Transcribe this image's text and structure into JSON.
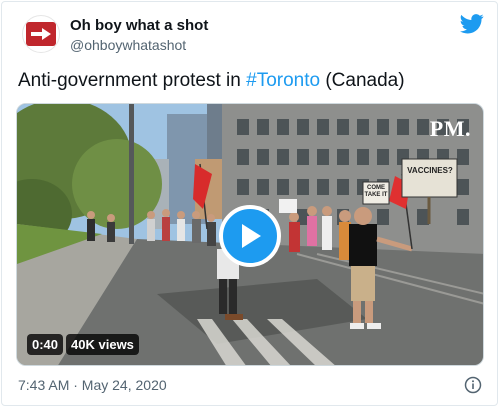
{
  "author": {
    "display_name": "Oh boy what a shot",
    "handle": "@ohboywhatashot"
  },
  "tweet": {
    "text_before": "Anti-government protest in ",
    "hashtag": "#Toronto",
    "text_after": " (Canada)"
  },
  "video": {
    "watermark": "PM.",
    "duration": "0:40",
    "views": "40K views",
    "signs": [
      "VACCINES?",
      "COME TAKE IT"
    ]
  },
  "footer": {
    "timestamp": "7:43 AM · May 24, 2020"
  },
  "colors": {
    "accent": "#1d9bf0",
    "avatar": "#c0272d",
    "text": "#0f1419",
    "muted": "#536471"
  },
  "icons": {
    "brand": "twitter-bird-icon",
    "info": "info-icon",
    "play": "play-icon",
    "avatar": "arrow-right-icon"
  }
}
